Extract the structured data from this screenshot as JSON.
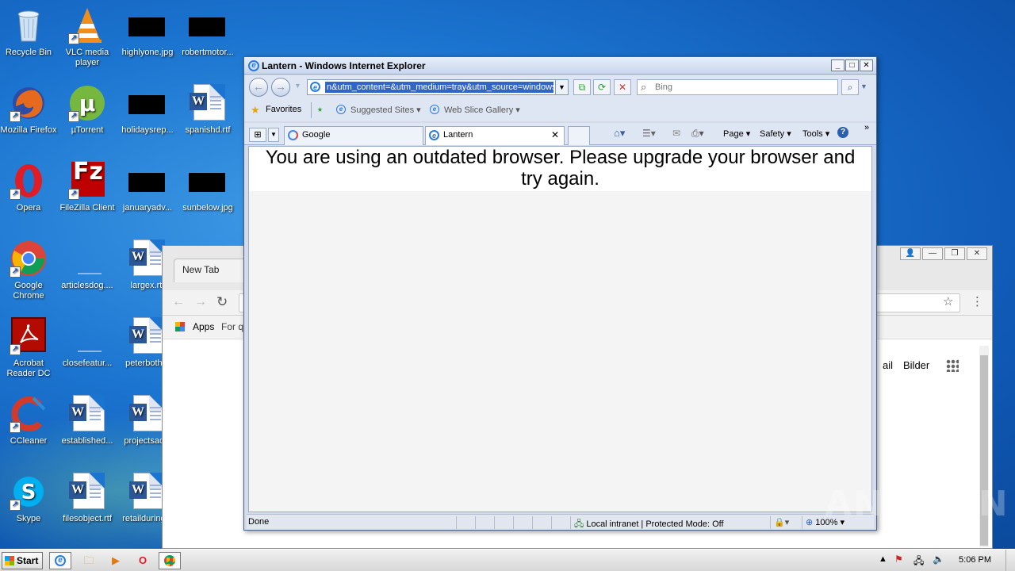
{
  "desktop": {
    "icons": [
      {
        "label": "Recycle Bin"
      },
      {
        "label": "VLC media player"
      },
      {
        "label": "highlyone.jpg"
      },
      {
        "label": "robertmotor..."
      },
      {
        "label": "Mozilla Firefox"
      },
      {
        "label": "µTorrent"
      },
      {
        "label": "holidaysrep..."
      },
      {
        "label": "spanishd.rtf"
      },
      {
        "label": "Opera"
      },
      {
        "label": "FileZilla Client"
      },
      {
        "label": "januaryadv..."
      },
      {
        "label": "sunbelow.jpg"
      },
      {
        "label": "Google Chrome"
      },
      {
        "label": "articlesdog...."
      },
      {
        "label": "largex.rtf"
      },
      {
        "label": "Acrobat Reader DC"
      },
      {
        "label": "closefeatur..."
      },
      {
        "label": "peterboth..."
      },
      {
        "label": "CCleaner"
      },
      {
        "label": "established..."
      },
      {
        "label": "projectsac..."
      },
      {
        "label": "Skype"
      },
      {
        "label": "filesobject.rtf"
      },
      {
        "label": "retailduring..."
      }
    ]
  },
  "chrome": {
    "tab_label": "New Tab",
    "apps_label": "Apps",
    "bookmark_partial": "For qu",
    "right_links": [
      "ail",
      "Bilder"
    ]
  },
  "ie": {
    "window_title": "Lantern - Windows Internet Explorer",
    "address_value": "n&utm_content=&utm_medium=tray&utm_source=windows",
    "search_placeholder": "Bing",
    "favorites_label": "Favorites",
    "suggested_sites": "Suggested Sites",
    "web_slice_gallery": "Web Slice Gallery",
    "tabs": [
      {
        "label": "Google",
        "active": false
      },
      {
        "label": "Lantern",
        "active": true
      }
    ],
    "command_bar": {
      "page": "Page",
      "safety": "Safety",
      "tools": "Tools"
    },
    "page_message": "You are using an outdated browser. Please upgrade your browser and try again.",
    "status": {
      "text": "Done",
      "zone": "Local intranet | Protected Mode: Off",
      "zoom": "100%"
    }
  },
  "taskbar": {
    "start_label": "Start",
    "clock": "5:06 PM"
  },
  "watermark": "ANY.RUN"
}
